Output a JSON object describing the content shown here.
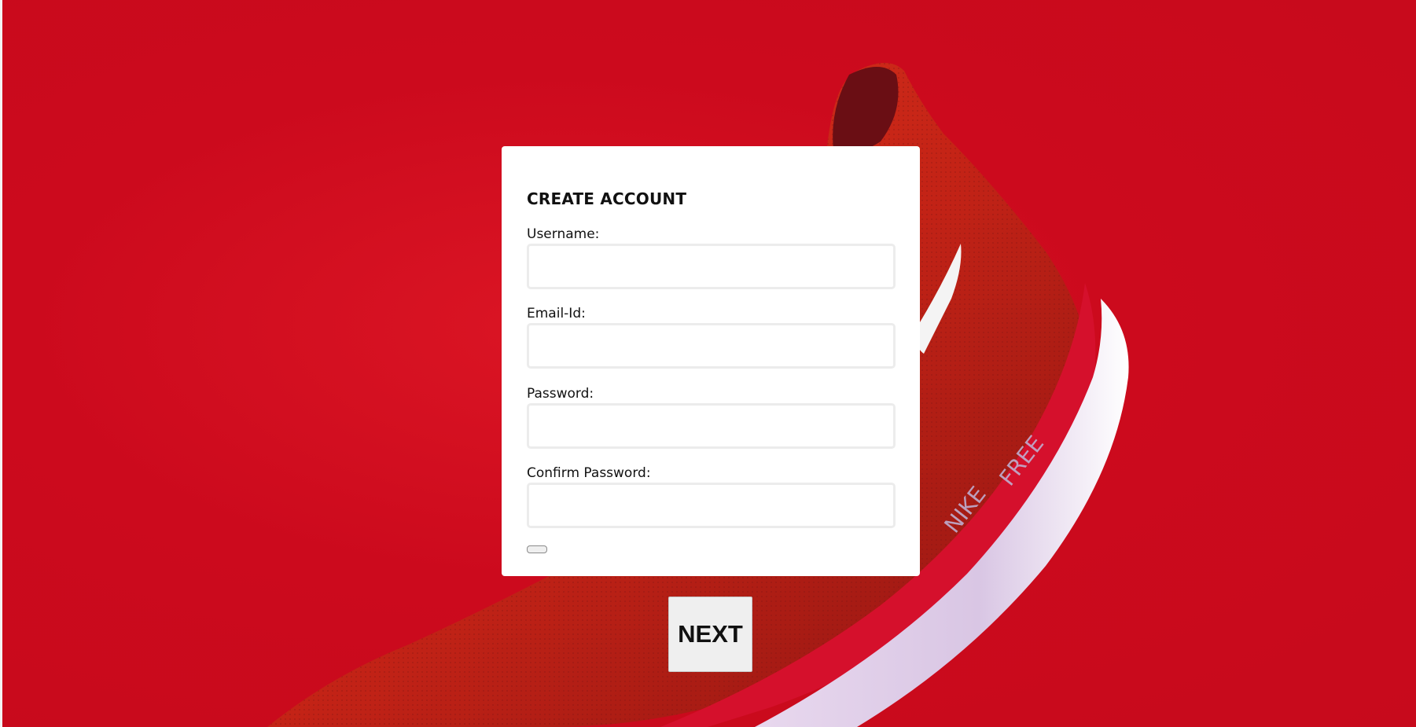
{
  "background": {
    "color": "#cc0a1d",
    "image": "red-knit-running-shoe",
    "shoe_sole_text": [
      "NIKE",
      "FREE"
    ]
  },
  "form": {
    "title": "CREATE ACCOUNT",
    "fields": [
      {
        "label": "Username:",
        "value": "",
        "placeholder": ""
      },
      {
        "label": "Email-Id:",
        "value": "",
        "placeholder": ""
      },
      {
        "label": "Password:",
        "value": "",
        "placeholder": ""
      },
      {
        "label": "Confirm Password:",
        "value": "",
        "placeholder": ""
      }
    ],
    "small_button_label": ""
  },
  "next_button": {
    "label": "NEXT"
  }
}
